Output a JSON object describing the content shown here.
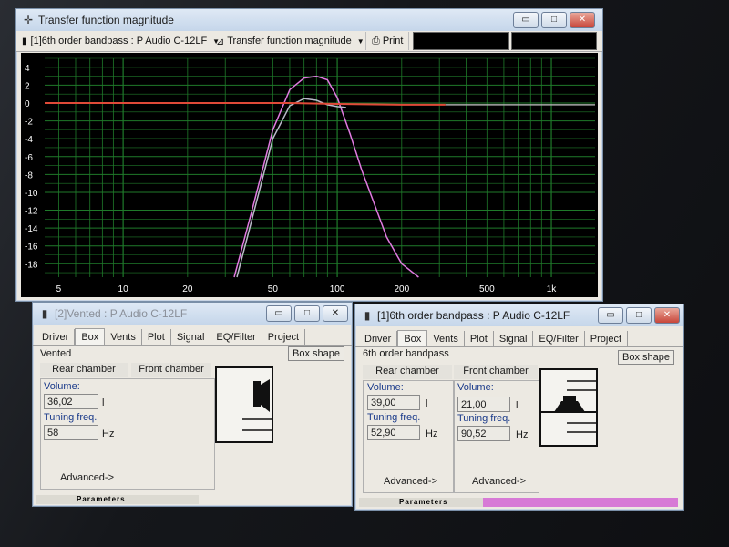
{
  "tf_window": {
    "title": "Transfer function magnitude",
    "toolbar": {
      "project": "[1]6th order bandpass : P Audio C-12LF",
      "view": "Transfer function magnitude",
      "print": "Print"
    },
    "buttons": {
      "minimize": "▭",
      "maximize": "□",
      "close": "✕"
    }
  },
  "chart_data": {
    "type": "line",
    "title": "",
    "xlabel": "",
    "ylabel": "",
    "x_scale": "log",
    "xlim": [
      4.3,
      1600
    ],
    "ylim": [
      -19.5,
      5
    ],
    "x_ticks": [
      5,
      10,
      20,
      50,
      100,
      200,
      500,
      "1k"
    ],
    "y_ticks": [
      4,
      2,
      0,
      -2,
      -4,
      -6,
      -8,
      -10,
      -12,
      -14,
      -16,
      -18
    ],
    "grid": true,
    "background": "#000000",
    "grid_color": "#1f7a2a",
    "series": [
      {
        "color": "#e07ae0",
        "x": [
          33,
          40,
          50,
          60,
          70,
          80,
          90,
          100,
          115,
          130,
          150,
          170,
          200,
          240
        ],
        "y": [
          -19.5,
          -12,
          -3,
          1.5,
          2.8,
          3,
          2.6,
          0.6,
          -3.5,
          -7.5,
          -11.5,
          -15,
          -18,
          -19.5
        ]
      },
      {
        "color": "#b9b9c8",
        "x": [
          34,
          40,
          50,
          60,
          70,
          80,
          90,
          100,
          110
        ],
        "y": [
          -19.5,
          -13,
          -4,
          -0.3,
          0.5,
          0.3,
          -0.2,
          -0.4,
          -0.5
        ]
      },
      {
        "color": "#e04a38",
        "x": [
          4.3,
          10,
          30,
          60,
          100,
          200,
          320
        ],
        "y": [
          0,
          0,
          0,
          0,
          -0.1,
          -0.2,
          -0.2
        ]
      },
      {
        "color": "#a8a8a8",
        "x": [
          320,
          500,
          1000,
          1600
        ],
        "y": [
          -0.2,
          -0.2,
          -0.2,
          -0.2
        ]
      }
    ]
  },
  "vented_window": {
    "title": "[2]Vented : P Audio C-12LF",
    "tabs": [
      "Driver",
      "Box",
      "Vents",
      "Plot",
      "Signal",
      "EQ/Filter",
      "Project"
    ],
    "active_tab": "Box",
    "box_type": "Vented",
    "box_shape_button": "Box shape",
    "rear_chamber": "Rear chamber",
    "front_chamber": "Front chamber",
    "volume_label": "Volume:",
    "volume": "36,02",
    "volume_unit": "l",
    "tuning_label": "Tuning freq.",
    "tuning": "58",
    "tuning_unit": "Hz",
    "advanced": "Advanced->",
    "status": "Parameters"
  },
  "bandpass_window": {
    "title": "[1]6th order bandpass : P Audio C-12LF",
    "tabs": [
      "Driver",
      "Box",
      "Vents",
      "Plot",
      "Signal",
      "EQ/Filter",
      "Project"
    ],
    "active_tab": "Box",
    "box_type": "6th order bandpass",
    "box_shape_button": "Box shape",
    "rear_chamber": "Rear chamber",
    "front_chamber": "Front chamber",
    "rear_volume_label": "Volume:",
    "rear_volume": "39,00",
    "rear_tuning_label": "Tuning freq.",
    "rear_tuning": "52,90",
    "front_volume_label": "Volume:",
    "front_volume": "21,00",
    "front_tuning_label": "Tuning freq.",
    "front_tuning": "90,52",
    "volume_unit": "l",
    "tuning_unit": "Hz",
    "advanced_rear": "Advanced->",
    "advanced_front": "Advanced->",
    "status": "Parameters",
    "status_accent": "#d77ad6"
  }
}
